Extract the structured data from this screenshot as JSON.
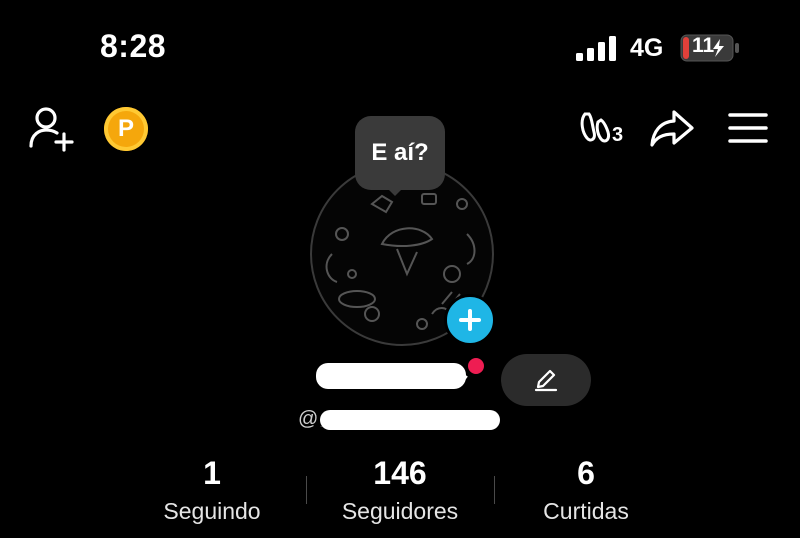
{
  "status_bar": {
    "time": "8:28",
    "network": "4G",
    "battery": "11",
    "battery_color": "#e0403a"
  },
  "top_nav": {
    "coin_label": "P",
    "footprint_count": "3"
  },
  "profile": {
    "bubble_text": "E aí?",
    "display_name": "(redacted)",
    "handle_prefix": "@",
    "handle": "(redacted)"
  },
  "stats": [
    {
      "value": "1",
      "label": "Seguindo"
    },
    {
      "value": "146",
      "label": "Seguidores"
    },
    {
      "value": "6",
      "label": "Curtidas"
    }
  ],
  "colors": {
    "accent_blue": "#1fb6e6",
    "notification_red": "#ee1d52",
    "coin": "#f5a70c"
  }
}
